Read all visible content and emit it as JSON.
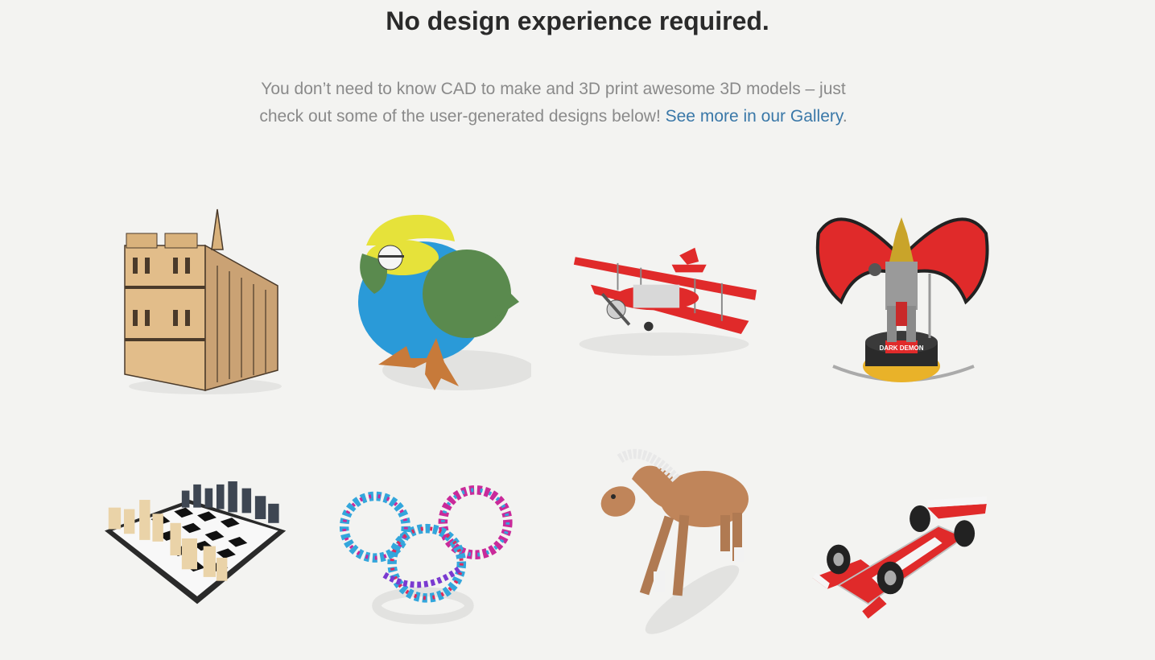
{
  "headline": "No design experience required.",
  "intro": {
    "text": "You don’t need to know CAD to make and 3D print awesome 3D models – just check out some of the user-generated designs below!",
    "link_text": "See more in our Gallery",
    "after_link": "."
  },
  "gallery": {
    "items": [
      {
        "name": "cathedral-model"
      },
      {
        "name": "bird-model"
      },
      {
        "name": "biplane-model"
      },
      {
        "name": "dark-demon-figure-model",
        "badge_text": "DARK DEMON"
      },
      {
        "name": "chess-set-model"
      },
      {
        "name": "twisted-knot-model"
      },
      {
        "name": "horse-model"
      },
      {
        "name": "race-car-model"
      }
    ]
  },
  "colors": {
    "background": "#f3f3f1",
    "headline": "#2a2a2a",
    "body_text": "#8a8a8a",
    "link": "#3a78a8"
  }
}
